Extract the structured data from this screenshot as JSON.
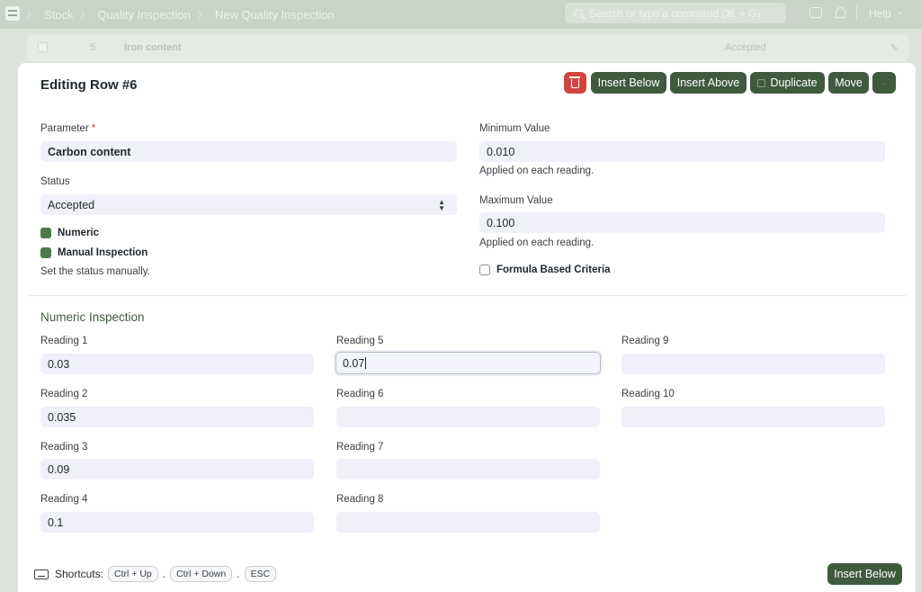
{
  "navbar": {
    "breadcrumbs": [
      "Stock",
      "Quality Inspection",
      "New Quality Inspection"
    ],
    "separator": "〉",
    "search_placeholder": "Search or type a command (⌘ + G)",
    "help_label": "Help"
  },
  "background_row": {
    "index": "5",
    "parameter": "Iron content",
    "status": "Accepted"
  },
  "editor": {
    "title": "Editing Row #6",
    "actions": {
      "insert_below": "Insert Below",
      "insert_above": "Insert Above",
      "duplicate": "Duplicate",
      "move": "Move"
    },
    "parameter": {
      "label": "Parameter",
      "required_mark": "*",
      "value": "Carbon content"
    },
    "status": {
      "label": "Status",
      "value": "Accepted"
    },
    "numeric": {
      "label": "Numeric",
      "checked": true
    },
    "manual_inspection": {
      "label": "Manual Inspection",
      "checked": true,
      "help": "Set the status manually."
    },
    "min_value": {
      "label": "Minimum Value",
      "value": "0.010",
      "help": "Applied on each reading."
    },
    "max_value": {
      "label": "Maximum Value",
      "value": "0.100",
      "help": "Applied on each reading."
    },
    "formula_based": {
      "label": "Formula Based Criteria",
      "checked": false
    },
    "section_title": "Numeric Inspection",
    "readings": [
      {
        "label": "Reading 1",
        "value": "0.03"
      },
      {
        "label": "Reading 2",
        "value": "0.035"
      },
      {
        "label": "Reading 3",
        "value": "0.09"
      },
      {
        "label": "Reading 4",
        "value": "0.1"
      },
      {
        "label": "Reading 5",
        "value": "0.07"
      },
      {
        "label": "Reading 6",
        "value": ""
      },
      {
        "label": "Reading 7",
        "value": ""
      },
      {
        "label": "Reading 8",
        "value": ""
      },
      {
        "label": "Reading 9",
        "value": ""
      },
      {
        "label": "Reading 10",
        "value": ""
      }
    ],
    "shortcuts": {
      "label": "Shortcuts:",
      "keys": [
        "Ctrl + Up",
        "Ctrl + Down",
        "ESC"
      ],
      "separator": "."
    },
    "footer_button": "Insert Below"
  },
  "colors": {
    "primary": "#3f5a3d",
    "danger": "#d0453f",
    "input_bg": "#f0f0fb",
    "overlay": "#dde4dc"
  }
}
